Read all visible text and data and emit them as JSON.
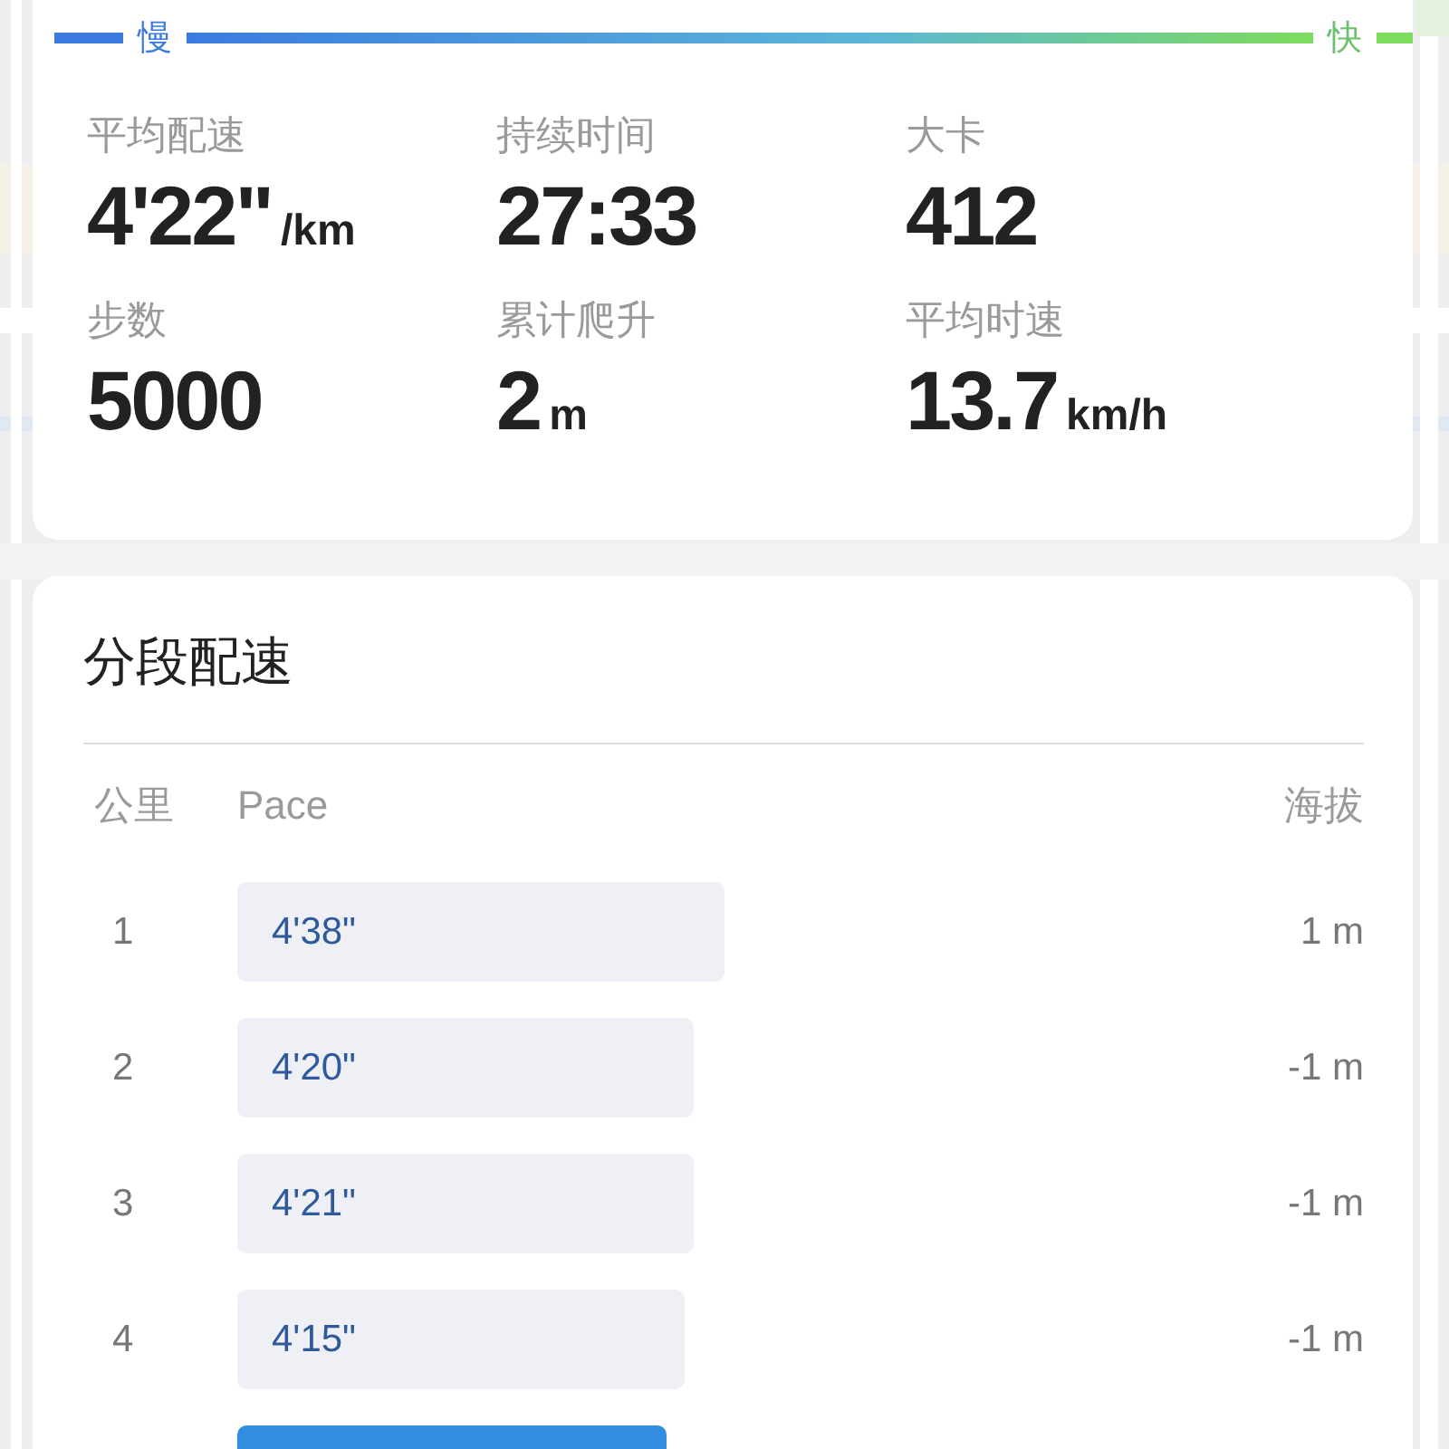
{
  "speed_legend": {
    "slow": "慢",
    "fast": "快"
  },
  "stats": [
    {
      "label": "平均配速",
      "value": "4'22\"",
      "unit": "/km"
    },
    {
      "label": "持续时间",
      "value": "27:33"
    },
    {
      "label": "大卡",
      "value": "412"
    },
    {
      "label": "步数",
      "value": "5000"
    },
    {
      "label": "累计爬升",
      "value": "2",
      "unit": "m"
    },
    {
      "label": "平均时速",
      "value": "13.7",
      "unit": "km/h"
    }
  ],
  "splits": {
    "title": "分段配速",
    "columns": [
      "公里",
      "Pace",
      "海拔"
    ],
    "rows": [
      {
        "km": "1",
        "pace": "4'38\"",
        "elevation": "1 m",
        "highlighted": false
      },
      {
        "km": "2",
        "pace": "4'20\"",
        "elevation": "-1 m",
        "highlighted": false
      },
      {
        "km": "3",
        "pace": "4'21\"",
        "elevation": "-1 m",
        "highlighted": false
      },
      {
        "km": "4",
        "pace": "4'15\"",
        "elevation": "-1 m",
        "highlighted": false
      },
      {
        "highlighted": true
      }
    ]
  }
}
